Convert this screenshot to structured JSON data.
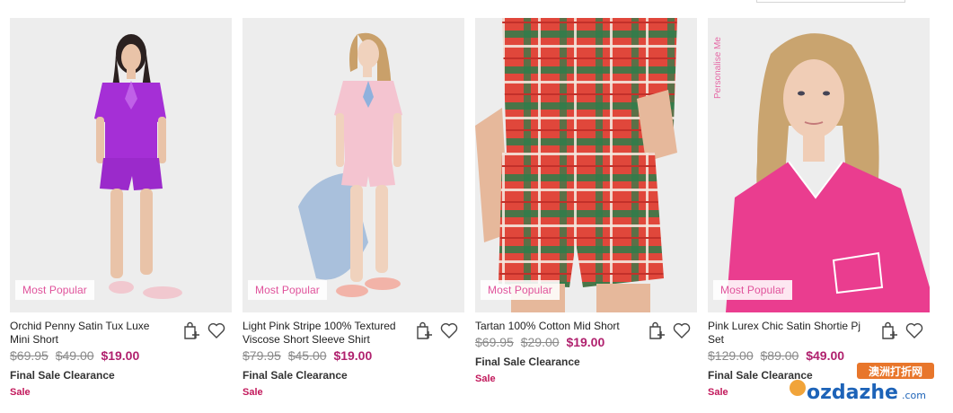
{
  "products": [
    {
      "badge": "Most Popular",
      "title": "Orchid Penny Satin Tux Luxe Mini Short",
      "prices": [
        "$69.95",
        "$49.00"
      ],
      "price": "$19.00",
      "clearance": "Final Sale Clearance",
      "sale": "Sale"
    },
    {
      "badge": "Most Popular",
      "title": "Light Pink Stripe 100% Textured Viscose Short Sleeve Shirt",
      "prices": [
        "$79.95",
        "$45.00"
      ],
      "price": "$19.00",
      "clearance": "Final Sale Clearance",
      "sale": "Sale"
    },
    {
      "badge": "Most Popular",
      "title": "Tartan 100% Cotton Mid Short",
      "prices": [
        "$69.95",
        "$29.00"
      ],
      "price": "$19.00",
      "clearance": "Final Sale Clearance",
      "sale": "Sale"
    },
    {
      "badge": "Most Popular",
      "title": "Pink Lurex Chic Satin Shortie Pj Set",
      "prices": [
        "$129.00",
        "$89.00"
      ],
      "price": "$49.00",
      "clearance": "Final Sale Clearance",
      "sale": "Sale",
      "overlay": "Personalise Me"
    }
  ],
  "icons": {
    "bag": "add-to-bag-icon",
    "wishlist": "heart-icon"
  },
  "colors": {
    "accent": "#b0216e",
    "badge_text": "#e0529b",
    "sale": "#c2185b"
  },
  "watermark": {
    "cn": "澳洲打折网",
    "site": "ozdazhe",
    "tld": ".com"
  }
}
